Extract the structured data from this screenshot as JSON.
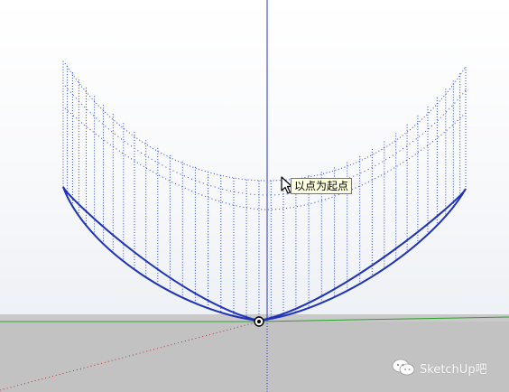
{
  "tooltip": {
    "text": "以点为起点"
  },
  "watermark": {
    "text": "SketchUp吧",
    "icon": "wechat-icon"
  },
  "colors": {
    "curve": "#1f33b5",
    "guide_dots": "#2a45d6",
    "blue_axis": "#2233cc",
    "green_axis": "#2e9e2e",
    "red_axis": "#c03030",
    "ground": "#c2c2c2",
    "tooltip_bg": "#ffffe1"
  }
}
